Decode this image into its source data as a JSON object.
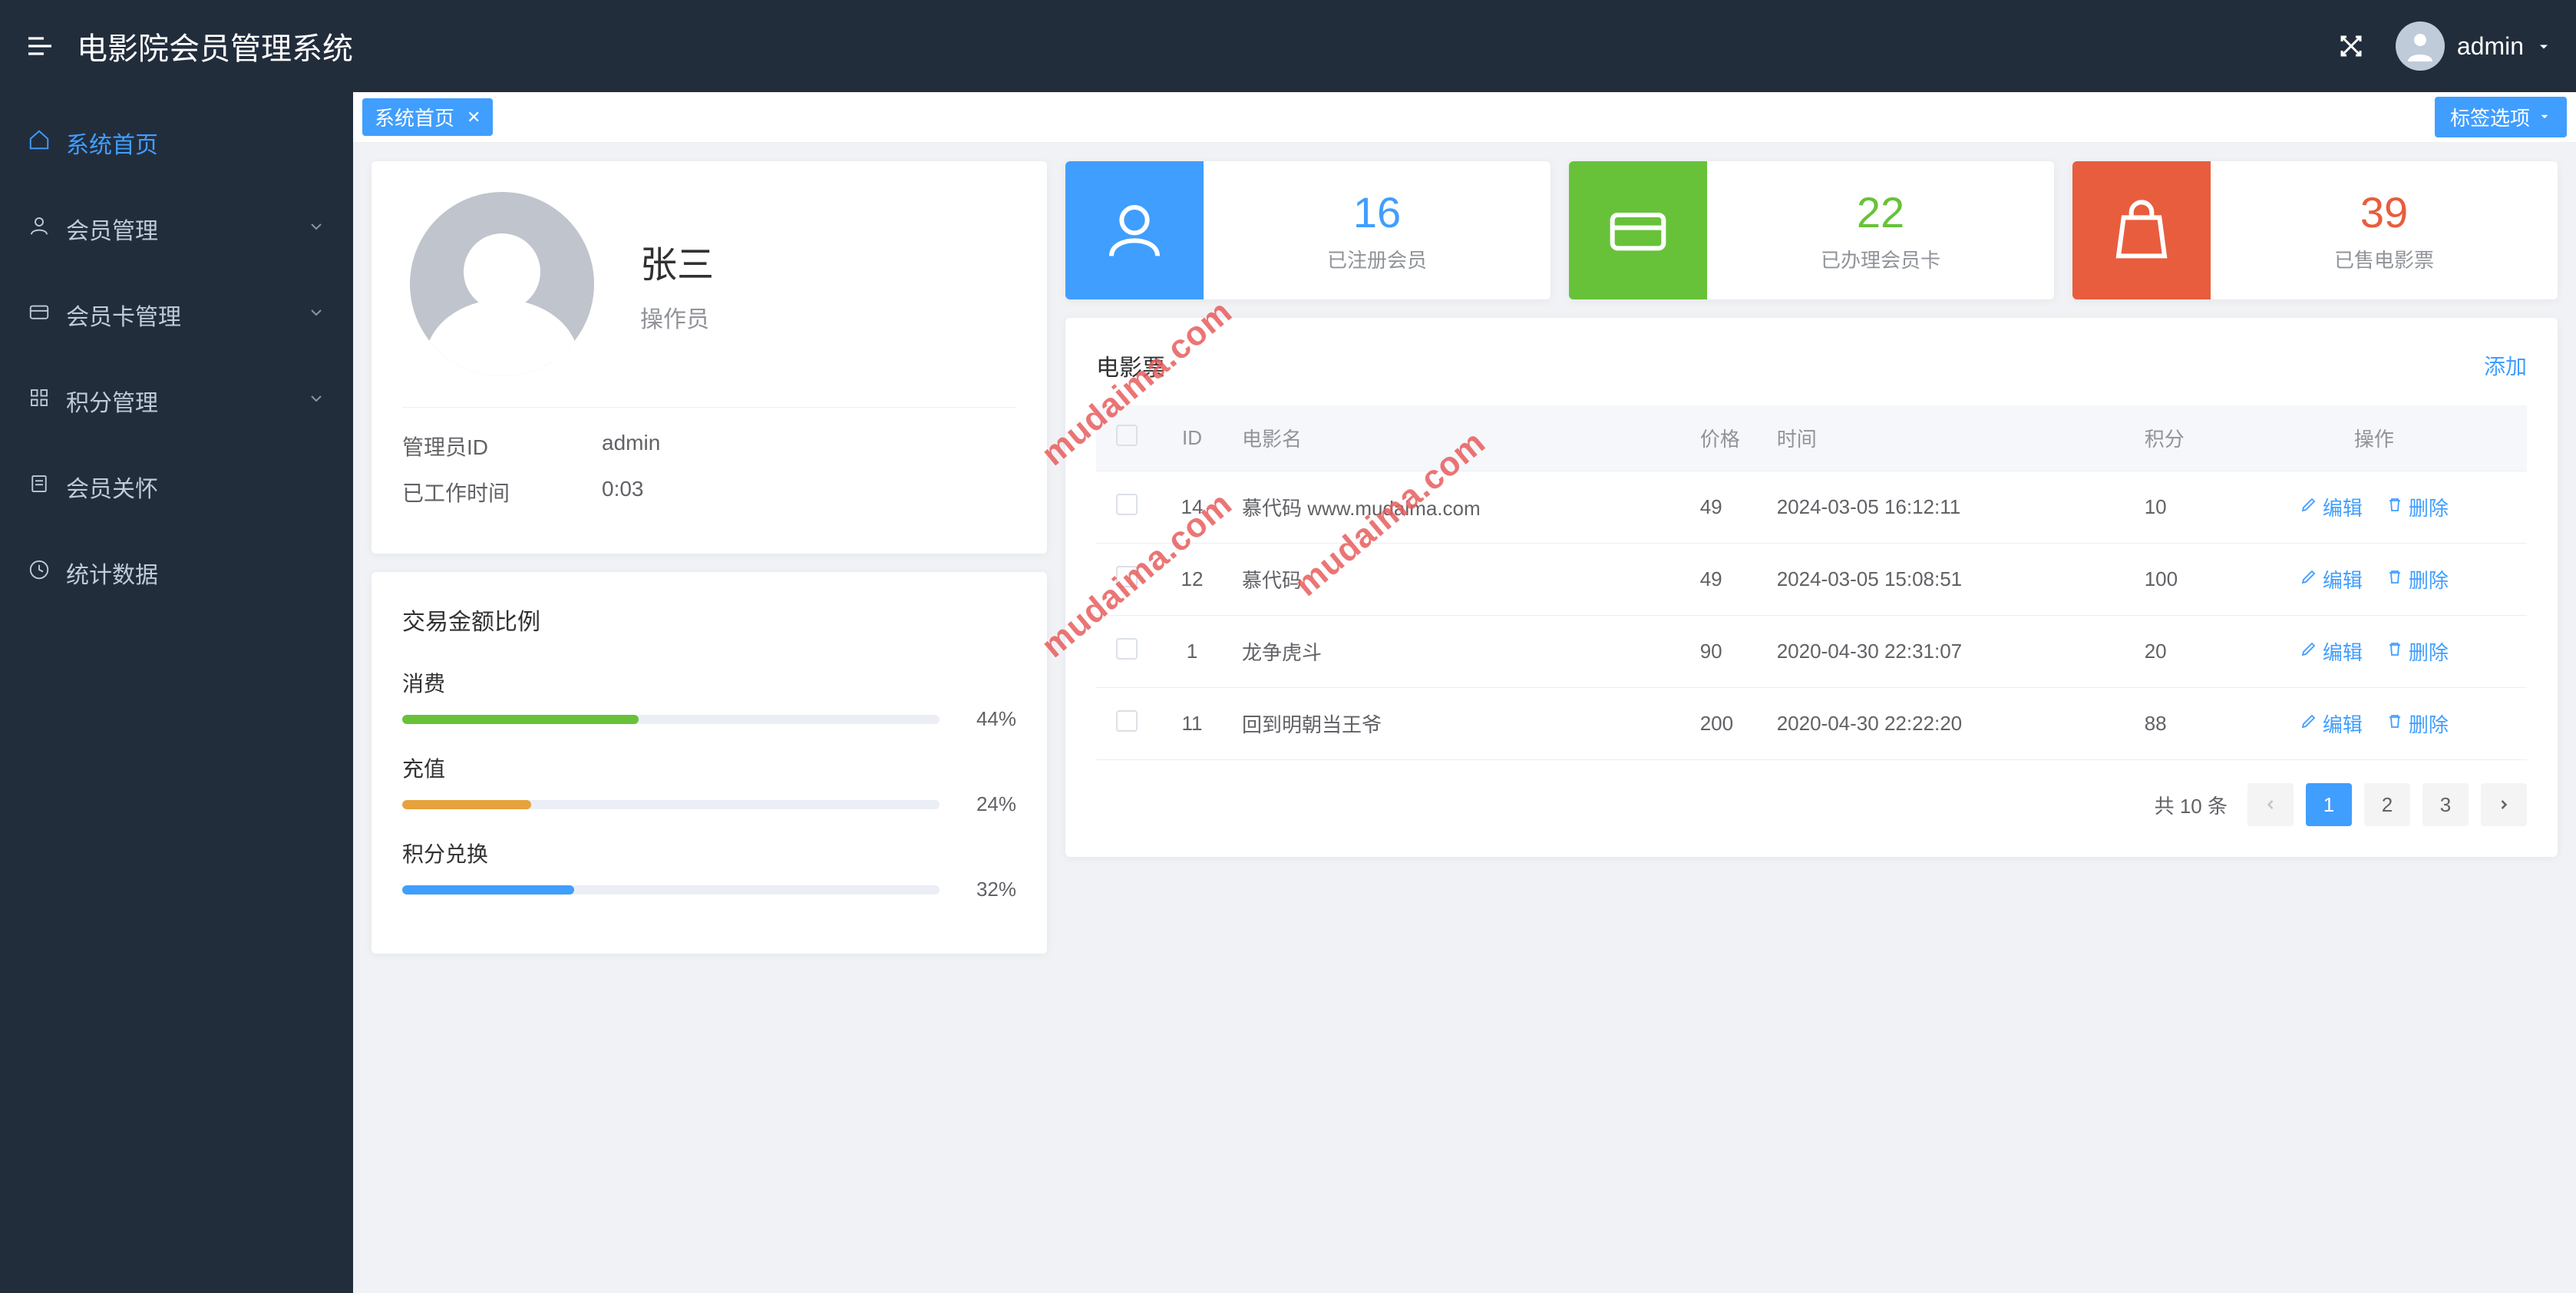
{
  "header": {
    "title": "电影院会员管理系统",
    "username": "admin"
  },
  "sidebar": {
    "items": [
      {
        "label": "系统首页",
        "icon": "home",
        "active": true,
        "expandable": false
      },
      {
        "label": "会员管理",
        "icon": "user",
        "active": false,
        "expandable": true
      },
      {
        "label": "会员卡管理",
        "icon": "card",
        "active": false,
        "expandable": true
      },
      {
        "label": "积分管理",
        "icon": "grid",
        "active": false,
        "expandable": true
      },
      {
        "label": "会员关怀",
        "icon": "note",
        "active": false,
        "expandable": false
      },
      {
        "label": "统计数据",
        "icon": "clock",
        "active": false,
        "expandable": false
      }
    ]
  },
  "tabs": {
    "active_tab": "系统首页",
    "options_label": "标签选项"
  },
  "profile": {
    "name": "张三",
    "role": "操作员",
    "id_label": "管理员ID",
    "id_value": "admin",
    "worktime_label": "已工作时间",
    "worktime_value": "0:03"
  },
  "progress": {
    "title": "交易金额比例",
    "items": [
      {
        "label": "消费",
        "pct": 44,
        "color": "#67c23a"
      },
      {
        "label": "充值",
        "pct": 24,
        "color": "#e6a23c"
      },
      {
        "label": "积分兑换",
        "pct": 32,
        "color": "#409eff"
      }
    ]
  },
  "stats": [
    {
      "num": "16",
      "label": "已注册会员",
      "color": "#409eff",
      "num_color": "#409eff",
      "icon": "user"
    },
    {
      "num": "22",
      "label": "已办理会员卡",
      "color": "#67c23a",
      "num_color": "#67c23a",
      "icon": "card"
    },
    {
      "num": "39",
      "label": "已售电影票",
      "color": "#e85d3d",
      "num_color": "#e85d3d",
      "icon": "bag"
    }
  ],
  "table": {
    "title": "电影票",
    "add_label": "添加",
    "columns": [
      "ID",
      "电影名",
      "价格",
      "时间",
      "积分",
      "操作"
    ],
    "edit_label": "编辑",
    "delete_label": "删除",
    "rows": [
      {
        "id": "14",
        "name": "慕代码 www.mudaima.com",
        "price": "49",
        "time": "2024-03-05 16:12:11",
        "points": "10"
      },
      {
        "id": "12",
        "name": "慕代码",
        "price": "49",
        "time": "2024-03-05 15:08:51",
        "points": "100"
      },
      {
        "id": "1",
        "name": "龙争虎斗",
        "price": "90",
        "time": "2020-04-30 22:31:07",
        "points": "20"
      },
      {
        "id": "11",
        "name": "回到明朝当王爷",
        "price": "200",
        "time": "2020-04-30 22:22:20",
        "points": "88"
      }
    ],
    "pagination": {
      "total_text": "共 10 条",
      "pages": [
        "1",
        "2",
        "3"
      ],
      "current": "1"
    }
  },
  "watermark": "mudaima.com"
}
